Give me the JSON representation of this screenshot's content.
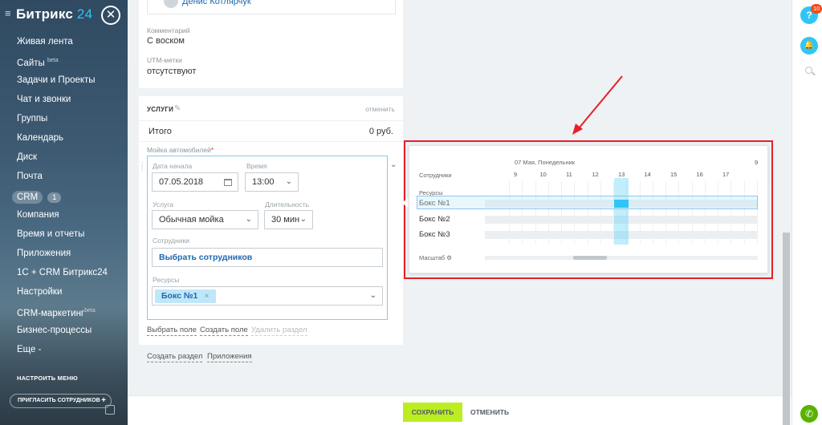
{
  "sidebar": {
    "logo_name": "Битрикс",
    "logo_num": "24",
    "close_glyph": "✕",
    "items": [
      {
        "label": "Живая лента",
        "sup": ""
      },
      {
        "label": "Сайты",
        "sup": "beta"
      },
      {
        "label": "Задачи и Проекты",
        "sup": ""
      },
      {
        "label": "Чат и звонки",
        "sup": ""
      },
      {
        "label": "Группы",
        "sup": ""
      },
      {
        "label": "Календарь",
        "sup": ""
      },
      {
        "label": "Диск",
        "sup": ""
      },
      {
        "label": "Почта",
        "sup": ""
      },
      {
        "label": "CRM",
        "sup": "",
        "count": "1"
      },
      {
        "label": "Компания",
        "sup": ""
      },
      {
        "label": "Время и отчеты",
        "sup": ""
      },
      {
        "label": "Приложения",
        "sup": ""
      },
      {
        "label": "1С + CRM Битрикс24",
        "sup": ""
      },
      {
        "label": "Настройки",
        "sup": ""
      },
      {
        "label": "CRM-маркетинг",
        "sup": "beta"
      },
      {
        "label": "Бизнес-процессы",
        "sup": ""
      },
      {
        "label": "Еще -",
        "sup": ""
      }
    ],
    "configure_menu": "НАСТРОИТЬ МЕНЮ",
    "invite": "ПРИГЛАСИТЬ СОТРУДНИКОВ",
    "invite_plus": "+"
  },
  "card_top": {
    "contact_name": "Денис Котлярчук",
    "comment_label": "Комментарий",
    "comment_value": "С воском",
    "utm_label": "UTM-метки",
    "utm_value": "отсутствуют"
  },
  "services": {
    "title": "УСЛУГИ",
    "cancel": "отменить",
    "total_label": "Итого",
    "total_value": "0 руб.",
    "section_label": "Мойка автомобилей",
    "required_mark": "*",
    "date_label": "Дата начала",
    "date_value": "07.05.2018",
    "time_label": "Время",
    "time_value": "13:00",
    "service_label": "Услуга",
    "service_value": "Обычная мойка",
    "duration_label": "Длительность",
    "duration_value": "30 мин",
    "staff_label": "Сотрудники",
    "staff_value": "Выбрать сотрудников",
    "resources_label": "Ресурсы",
    "resource_tag": "Бокс №1",
    "tag_remove": "×",
    "choose_field": "Выбрать поле",
    "create_field": "Создать поле",
    "delete_section": "Удалить раздел"
  },
  "bottom_links": {
    "create_section": "Создать раздел",
    "apps": "Приложения"
  },
  "scheduler": {
    "date_header": "07 Мая, Понедельник",
    "staff_header": "Сотрудники",
    "resources_header": "Ресурсы",
    "hours": [
      "9",
      "10",
      "11",
      "12",
      "13",
      "14",
      "15",
      "16",
      "17"
    ],
    "hour_partial": "9",
    "resources": [
      "Бокс №1",
      "Бокс №2",
      "Бокс №3"
    ],
    "scale_label": "Масштаб",
    "highlight_hour": "13",
    "highlight_color": "#2fc6f6"
  },
  "footer": {
    "save": "СОХРАНИТЬ",
    "cancel": "ОТМЕНИТЬ",
    "save_color": "#bbed21"
  },
  "right_bar": {
    "help": "?",
    "help_badge": "10",
    "bell_glyph": "🔔",
    "phone_glyph": "✆"
  },
  "annotation": {
    "color": "#e5202a"
  }
}
